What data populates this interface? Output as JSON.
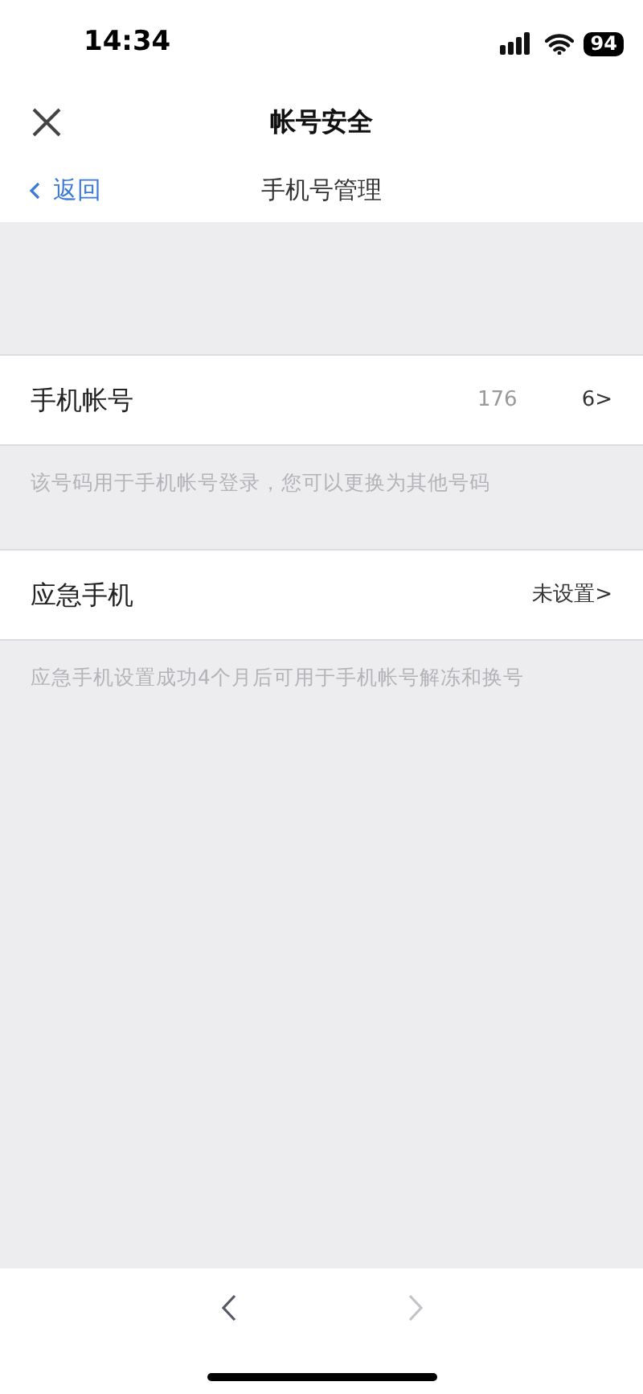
{
  "status_bar": {
    "time": "14:34",
    "battery": "94"
  },
  "header": {
    "title": "帐号安全"
  },
  "subheader": {
    "back": "返回",
    "title": "手机号管理"
  },
  "rows": [
    {
      "label": "手机帐号",
      "value_parts": [
        "176",
        "6>"
      ],
      "hint": "该号码用于手机帐号登录，您可以更换为其他号码"
    },
    {
      "label": "应急手机",
      "value_parts": [
        "未设置>"
      ],
      "hint": "应急手机设置成功4个月后可用于手机帐号解冻和换号"
    }
  ],
  "bottom_nav": [
    {
      "kind": "back",
      "disabled": false
    },
    {
      "kind": "forward",
      "disabled": true
    }
  ]
}
